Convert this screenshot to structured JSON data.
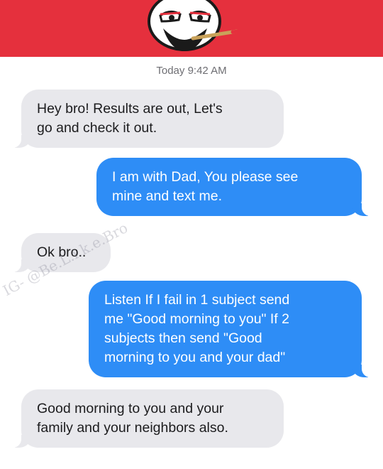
{
  "header": {
    "color": "#e5303d",
    "logo_icon": "cartoon-face-smoking-icon"
  },
  "timestamp": "Today 9:42 AM",
  "messages": [
    {
      "direction": "incoming",
      "text": "Hey bro! Results are out, Let's\ngo and check it out."
    },
    {
      "direction": "outgoing",
      "text": "I am with Dad, You please see\nmine and text me."
    },
    {
      "direction": "incoming",
      "text": "Ok bro.."
    },
    {
      "direction": "outgoing",
      "text": "Listen If I fail in 1 subject send\nme \"Good morning to you\" If 2\nsubjects then send \"Good\nmorning to you and your dad\""
    },
    {
      "direction": "incoming",
      "text": "Good morning to you and your\nfamily and your neighbors also."
    }
  ],
  "colors": {
    "incoming_bubble": "#e8e8ec",
    "outgoing_bubble": "#2e8df6"
  },
  "watermark": "IG- @Be.L.i.k.e.Bro"
}
